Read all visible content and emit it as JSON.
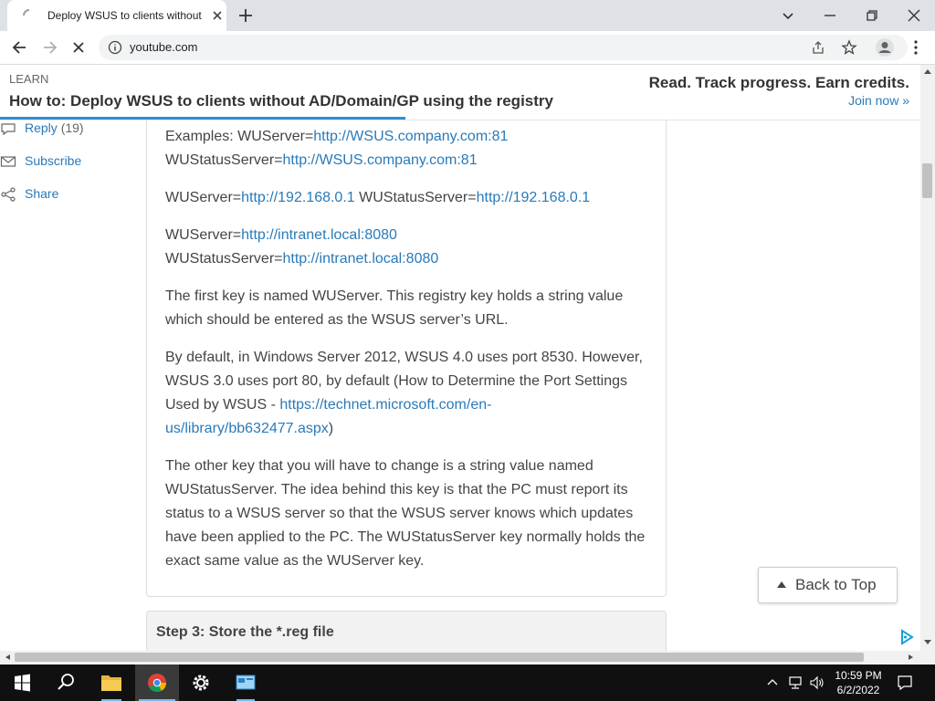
{
  "browser": {
    "tab_title": "Deploy WSUS to clients without AD/Domain/GP using the registry",
    "url": "youtube.com"
  },
  "header": {
    "section": "LEARN",
    "title": "How to: Deploy WSUS to clients without AD/Domain/GP using the registry",
    "promo": "Read. Track progress. Earn credits.",
    "join": "Join now »",
    "reading_progress": 0.44
  },
  "sidebar": {
    "reply_label": "Reply",
    "reply_count": "(19)",
    "subscribe_label": "Subscribe",
    "share_label": "Share"
  },
  "content": {
    "p1": {
      "prefix": "Examples: WUServer=",
      "link1": "http://WSUS.company.com:81",
      "mid": "WUStatusServer=",
      "link2": "http://WSUS.company.com:81"
    },
    "p2": {
      "prefix": "WUServer=",
      "link1": "http://192.168.0.1",
      "mid": " WUStatusServer=",
      "link2": "http://192.168.0.1"
    },
    "p3": {
      "prefix": "WUServer=",
      "link1": "http://intranet.local:8080",
      "mid": "WUStatusServer=",
      "link2": "http://intranet.local:8080"
    },
    "p4": "The first key is named WUServer. This registry key holds a string value which should be entered as the WSUS server’s URL.",
    "p5": {
      "text": "By default, in Windows Server 2012, WSUS 4.0 uses port 8530. However, WSUS 3.0 uses port 80, by default (How to Determine the Port Settings Used by WSUS - ",
      "link": "https://technet.microsoft.com/en-us/library/bb632477.aspx",
      "end": ")"
    },
    "p6": "The other key that you will have to change is a string value named WUStatusServer. The idea behind this key is that the PC must report its status to a WSUS server so that the WSUS server knows which updates have been applied to the PC. The WUStatusServer key normally holds the exact same value as the WUServer key.",
    "step3_title": "Step 3: Store the *.reg file"
  },
  "back_to_top": "Back to Top",
  "taskbar": {
    "time": "10:59 PM",
    "date": "6/2/2022"
  },
  "colors": {
    "link": "#2a7ab8",
    "progress": "#2e8fd6",
    "taskbar": "#101010"
  }
}
